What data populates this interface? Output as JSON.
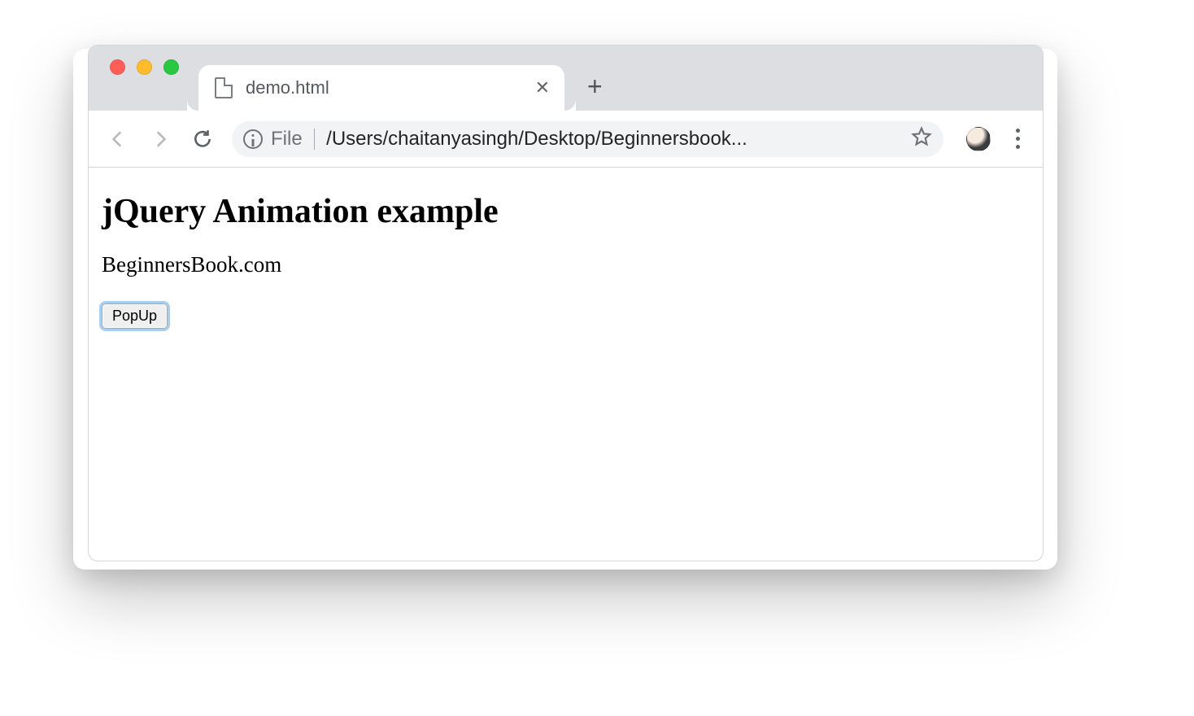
{
  "browser": {
    "tab": {
      "title": "demo.html"
    },
    "toolbar": {
      "scheme_label": "File",
      "path": "/Users/chaitanyasingh/Desktop/Beginnersbook..."
    }
  },
  "page": {
    "heading": "jQuery Animation example",
    "paragraph": "BeginnersBook.com",
    "button_label": "PopUp"
  }
}
